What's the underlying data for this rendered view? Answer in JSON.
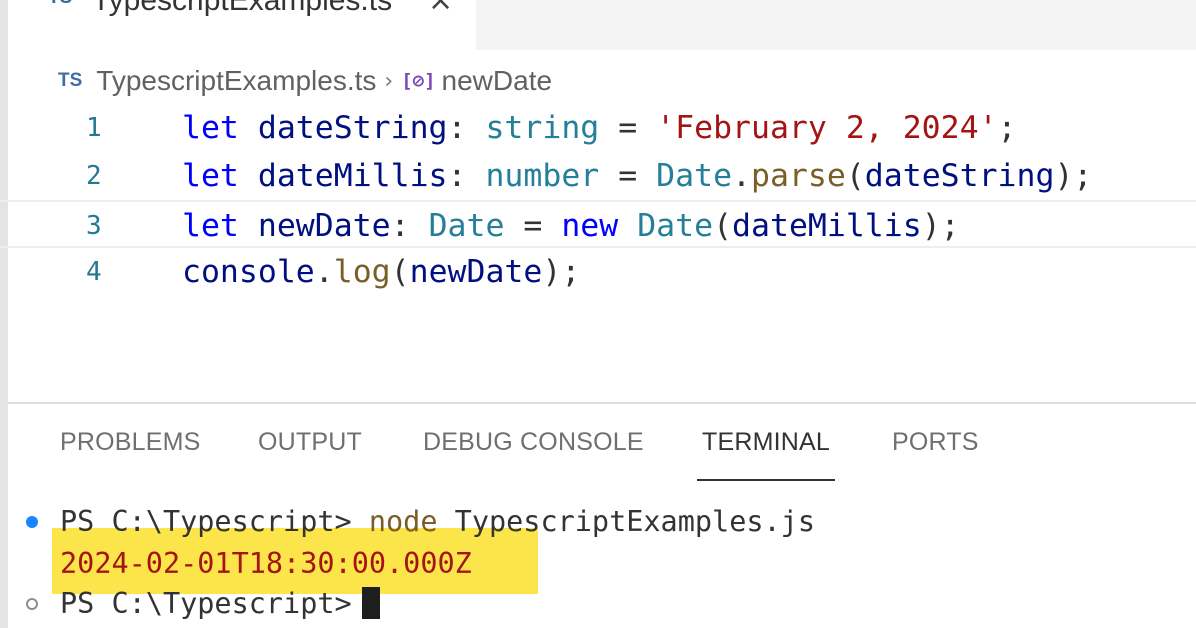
{
  "tab": {
    "icon_label": "TS",
    "file_name": "TypescriptExamples.ts",
    "close_glyph": "×"
  },
  "breadcrumb": {
    "icon_label": "TS",
    "file": "TypescriptExamples.ts",
    "separator": "›",
    "symbol_glyph": "[⊘]",
    "symbol": "newDate"
  },
  "code": {
    "lines": [
      {
        "number": "1",
        "tokens": [
          {
            "t": "let",
            "c": "kw"
          },
          {
            "t": " ",
            "c": "pl"
          },
          {
            "t": "dateString",
            "c": "var"
          },
          {
            "t": ": ",
            "c": "pl"
          },
          {
            "t": "string",
            "c": "typ"
          },
          {
            "t": " = ",
            "c": "pl"
          },
          {
            "t": "'February 2, 2024'",
            "c": "str"
          },
          {
            "t": ";",
            "c": "pl"
          }
        ]
      },
      {
        "number": "2",
        "tokens": [
          {
            "t": "let",
            "c": "kw"
          },
          {
            "t": " ",
            "c": "pl"
          },
          {
            "t": "dateMillis",
            "c": "var"
          },
          {
            "t": ": ",
            "c": "pl"
          },
          {
            "t": "number",
            "c": "typ"
          },
          {
            "t": " = ",
            "c": "pl"
          },
          {
            "t": "Date",
            "c": "typ"
          },
          {
            "t": ".",
            "c": "pl"
          },
          {
            "t": "parse",
            "c": "fn"
          },
          {
            "t": "(",
            "c": "pl"
          },
          {
            "t": "dateString",
            "c": "var"
          },
          {
            "t": ");",
            "c": "pl"
          }
        ]
      },
      {
        "number": "3",
        "tokens": [
          {
            "t": "let",
            "c": "kw"
          },
          {
            "t": " ",
            "c": "pl"
          },
          {
            "t": "newDate",
            "c": "var"
          },
          {
            "t": ": ",
            "c": "pl"
          },
          {
            "t": "Date",
            "c": "typ"
          },
          {
            "t": " = ",
            "c": "pl"
          },
          {
            "t": "new",
            "c": "kw"
          },
          {
            "t": " ",
            "c": "pl"
          },
          {
            "t": "Date",
            "c": "typ"
          },
          {
            "t": "(",
            "c": "pl"
          },
          {
            "t": "dateMillis",
            "c": "var"
          },
          {
            "t": ");",
            "c": "pl"
          }
        ]
      },
      {
        "number": "4",
        "tokens": [
          {
            "t": "console",
            "c": "var"
          },
          {
            "t": ".",
            "c": "pl"
          },
          {
            "t": "log",
            "c": "fn"
          },
          {
            "t": "(",
            "c": "pl"
          },
          {
            "t": "newDate",
            "c": "var"
          },
          {
            "t": ");",
            "c": "pl"
          }
        ]
      }
    ]
  },
  "panel": {
    "tabs": {
      "problems": "PROBLEMS",
      "output": "OUTPUT",
      "debug_console": "DEBUG CONSOLE",
      "terminal": "TERMINAL",
      "ports": "PORTS"
    },
    "active_tab": "terminal"
  },
  "terminal": {
    "prompt": "PS C:\\Typescript> ",
    "command": "node",
    "command_arg": " TypescriptExamples.js",
    "output": "2024-02-01T18:30:00.000Z",
    "prompt2": "PS C:\\Typescript>"
  },
  "colors": {
    "highlight": "#fbe54a",
    "keyword": "#0000ff",
    "type": "#267f99",
    "string": "#a31515",
    "function": "#795e26",
    "variable": "#001080",
    "status_dot": "#1a85ff"
  }
}
